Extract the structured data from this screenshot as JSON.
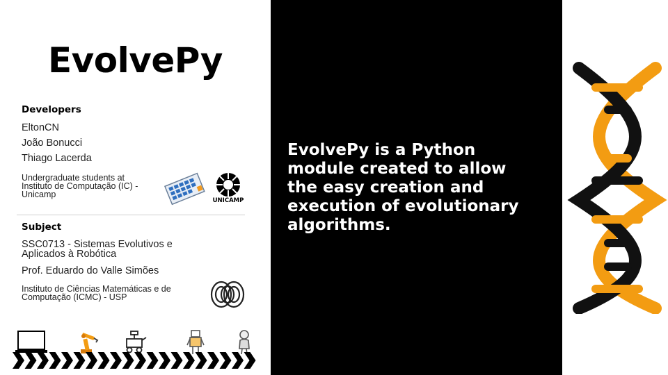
{
  "title": "EvolvePy",
  "developers": {
    "heading": "Developers",
    "names": [
      "EltonCN",
      "João Bonucci",
      "Thiago Lacerda"
    ],
    "note_lines": [
      "Undergraduate students at",
      "Instituto de Computação (IC) -",
      "Unicamp"
    ],
    "unicamp_label": "UNICAMP"
  },
  "subject": {
    "heading": "Subject",
    "course_lines": [
      "SSC0713 - Sistemas Evolutivos e",
      "Aplicados à Robótica"
    ],
    "professor": "Prof. Eduardo do Valle Simões",
    "institute_lines": [
      "Instituto de Ciências Matemáticas e de",
      "Computação (ICMC) - USP"
    ]
  },
  "description_lines": [
    "EvolvePy is a Python",
    "module created to allow",
    "the easy creation and",
    "execution of evolutionary",
    "algorithms."
  ],
  "colors": {
    "background_dark": "#000000",
    "accent_orange": "#f39c12",
    "text_light": "#ffffff"
  },
  "icons": [
    "laptop-icon",
    "robot-arm-icon",
    "rover-robot-icon",
    "humanoid-robot-icon",
    "android-robot-icon",
    "arrow-chevron-icon",
    "dna-helix-icon",
    "ic-logo-icon",
    "unicamp-logo-icon",
    "usp-logo-icon"
  ]
}
